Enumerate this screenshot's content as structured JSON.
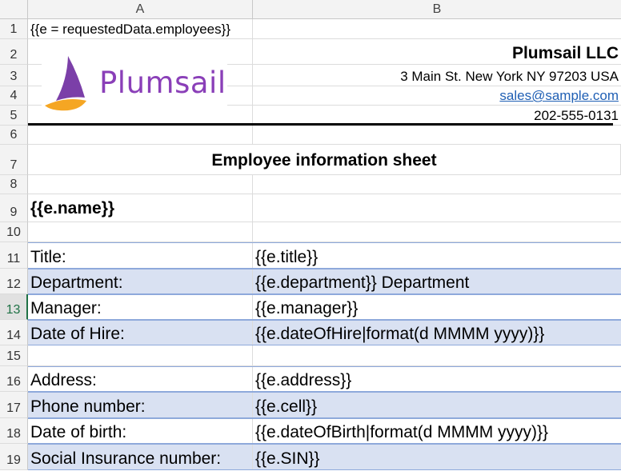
{
  "columns": [
    "A",
    "B"
  ],
  "logo": {
    "text": "Plumsail",
    "sail_colors": [
      "#7b3fa8",
      "#f5a623"
    ]
  },
  "rows": [
    {
      "num": "1",
      "a": "{{e = requestedData.employees}}",
      "b": ""
    },
    {
      "num": "2",
      "a": "",
      "b": "Plumsail LLC"
    },
    {
      "num": "3",
      "a": "",
      "b": "3 Main St. New York NY 97203 USA"
    },
    {
      "num": "4",
      "a": "",
      "b": "sales@sample.com"
    },
    {
      "num": "5",
      "a": "",
      "b": "202-555-0131"
    },
    {
      "num": "6",
      "a": "",
      "b": ""
    },
    {
      "num": "7",
      "a": "Employee information sheet",
      "b": ""
    },
    {
      "num": "8",
      "a": "",
      "b": ""
    },
    {
      "num": "9",
      "a": "{{e.name}}",
      "b": ""
    },
    {
      "num": "10",
      "a": "",
      "b": ""
    },
    {
      "num": "11",
      "a": "Title:",
      "b": "{{e.title}}"
    },
    {
      "num": "12",
      "a": "Department:",
      "b": "{{e.department}} Department"
    },
    {
      "num": "13",
      "a": "Manager:",
      "b": "{{e.manager}}"
    },
    {
      "num": "14",
      "a": "Date of Hire:",
      "b": "{{e.dateOfHire|format(d MMMM yyyy)}}"
    },
    {
      "num": "15",
      "a": "",
      "b": ""
    },
    {
      "num": "16",
      "a": "Address:",
      "b": "{{e.address}}"
    },
    {
      "num": "17",
      "a": "Phone number:",
      "b": "{{e.cell}}"
    },
    {
      "num": "18",
      "a": "Date of birth:",
      "b": "{{e.dateOfBirth|format(d MMMM yyyy)}}"
    },
    {
      "num": "19",
      "a": "Social Insurance number:",
      "b": "{{e.SIN}}"
    }
  ],
  "selected_row": "13",
  "colors": {
    "band": "#d9e1f2",
    "band_border": "#8ea9db",
    "link": "#1f5fb4",
    "selection": "#1e7145"
  }
}
